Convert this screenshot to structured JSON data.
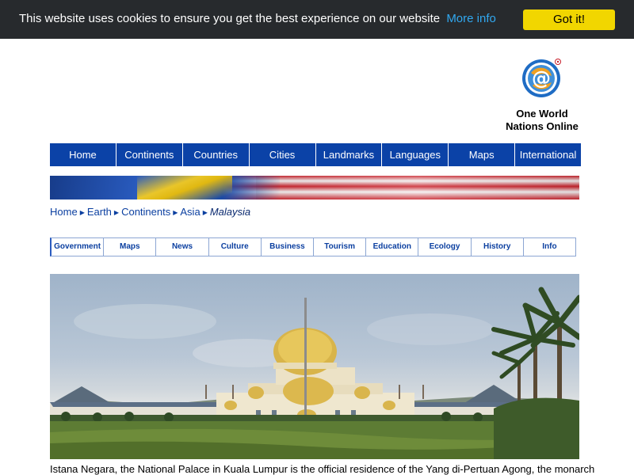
{
  "cookie": {
    "message": "This website uses cookies to ensure you get the best experience on our website",
    "more_info": "More info",
    "button": "Got it!"
  },
  "logo": {
    "line1": "One World",
    "line2": "Nations Online"
  },
  "main_nav": {
    "items": [
      "Home",
      "Continents",
      "Countries",
      "Cities",
      "Landmarks",
      "Languages",
      "Maps",
      "International"
    ]
  },
  "breadcrumb": {
    "items": [
      "Home",
      "Earth",
      "Continents",
      "Asia"
    ],
    "current": "Malaysia"
  },
  "sub_nav": {
    "items": [
      "Government",
      "Maps",
      "News",
      "Culture",
      "Business",
      "Tourism",
      "Education",
      "Ecology",
      "History",
      "Info"
    ]
  },
  "photo": {
    "caption": "Istana Negara, the National Palace in Kuala Lumpur is the official residence of the Yang di-Pertuan Agong, the monarch"
  },
  "colors": {
    "cookie_bg": "#272a2d",
    "cookie_link": "#31a8f0",
    "cookie_button": "#f1d600",
    "nav_bg": "#0b42a7",
    "link": "#0b3fa0"
  }
}
